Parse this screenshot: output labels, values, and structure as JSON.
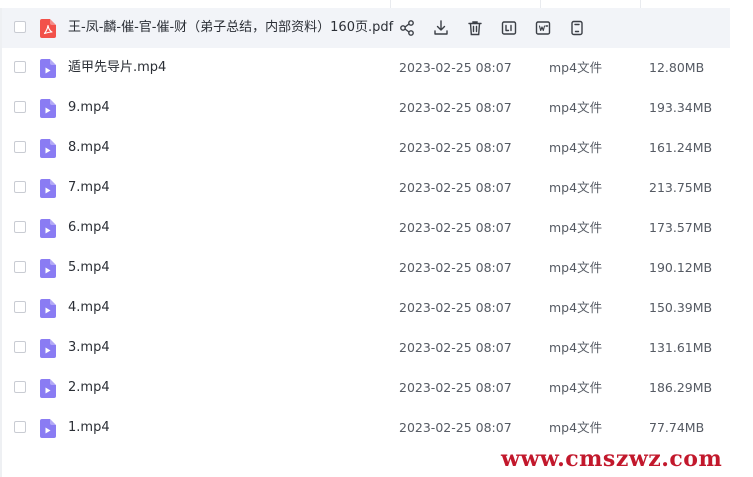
{
  "files": [
    {
      "name": "王-凤-麟-催-官-催-财（弟子总结，内部资料）160页.pdf",
      "kind": "pdf",
      "date": "",
      "type": "",
      "size": "",
      "hovered": true
    },
    {
      "name": "遁甲先导片.mp4",
      "kind": "mp4",
      "date": "2023-02-25 08:07",
      "type": "mp4文件",
      "size": "12.80MB",
      "hovered": false
    },
    {
      "name": "9.mp4",
      "kind": "mp4",
      "date": "2023-02-25 08:07",
      "type": "mp4文件",
      "size": "193.34MB",
      "hovered": false
    },
    {
      "name": "8.mp4",
      "kind": "mp4",
      "date": "2023-02-25 08:07",
      "type": "mp4文件",
      "size": "161.24MB",
      "hovered": false
    },
    {
      "name": "7.mp4",
      "kind": "mp4",
      "date": "2023-02-25 08:07",
      "type": "mp4文件",
      "size": "213.75MB",
      "hovered": false
    },
    {
      "name": "6.mp4",
      "kind": "mp4",
      "date": "2023-02-25 08:07",
      "type": "mp4文件",
      "size": "173.57MB",
      "hovered": false
    },
    {
      "name": "5.mp4",
      "kind": "mp4",
      "date": "2023-02-25 08:07",
      "type": "mp4文件",
      "size": "190.12MB",
      "hovered": false
    },
    {
      "name": "4.mp4",
      "kind": "mp4",
      "date": "2023-02-25 08:07",
      "type": "mp4文件",
      "size": "150.39MB",
      "hovered": false
    },
    {
      "name": "3.mp4",
      "kind": "mp4",
      "date": "2023-02-25 08:07",
      "type": "mp4文件",
      "size": "131.61MB",
      "hovered": false
    },
    {
      "name": "2.mp4",
      "kind": "mp4",
      "date": "2023-02-25 08:07",
      "type": "mp4文件",
      "size": "186.29MB",
      "hovered": false
    },
    {
      "name": "1.mp4",
      "kind": "mp4",
      "date": "2023-02-25 08:07",
      "type": "mp4文件",
      "size": "77.74MB",
      "hovered": false
    }
  ],
  "row_actions": [
    {
      "name": "share-icon"
    },
    {
      "name": "download-icon"
    },
    {
      "name": "delete-icon"
    },
    {
      "name": "rename-icon"
    },
    {
      "name": "word-convert-icon"
    },
    {
      "name": "more-file-icon"
    }
  ],
  "colors": {
    "pdf_icon": "#f2514a",
    "video_icon": "#8a7cf3",
    "action_icon": "#3b3f46",
    "watermark": "#c2182c"
  },
  "watermark": "www.cmszwz.com"
}
